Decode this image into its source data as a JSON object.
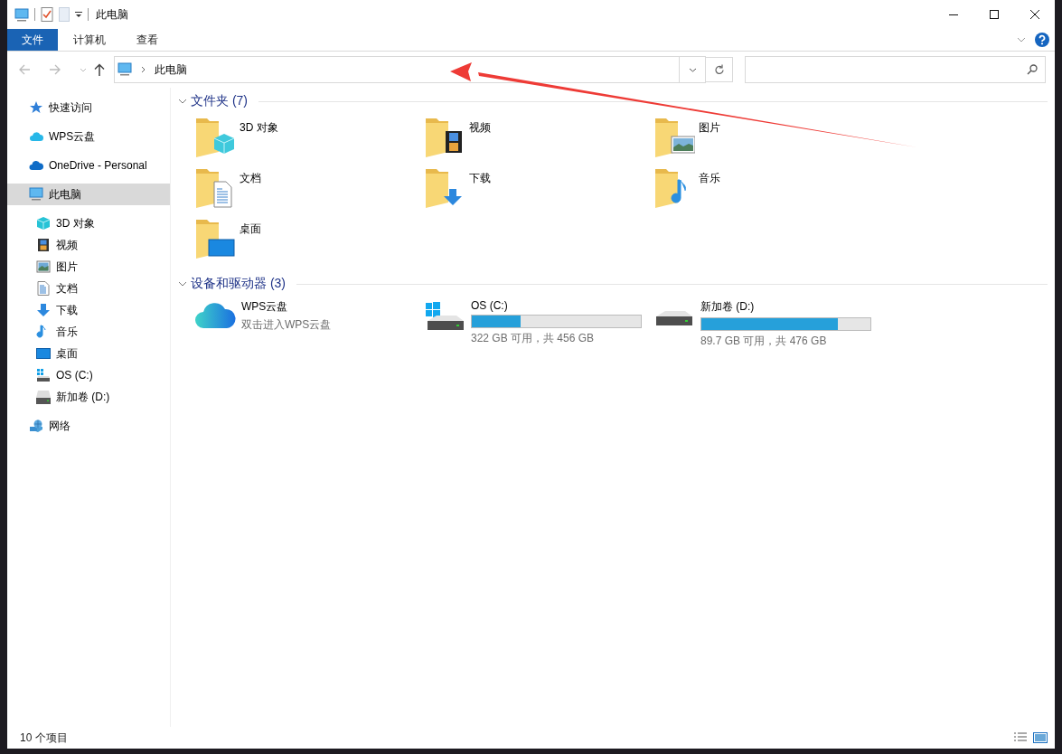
{
  "window": {
    "title": "此电脑"
  },
  "ribbon_tabs": [
    {
      "label": "文件",
      "selected": true
    },
    {
      "label": "计算机",
      "selected": false
    },
    {
      "label": "查看",
      "selected": false
    }
  ],
  "address_bar": {
    "path": "此电脑"
  },
  "sidebar": {
    "items": [
      {
        "label": "快速访问",
        "selected": false
      },
      {
        "label": "WPS云盘",
        "selected": false
      },
      {
        "label": "OneDrive - Personal",
        "selected": false
      },
      {
        "label": "此电脑",
        "selected": true,
        "children": [
          {
            "label": "3D 对象",
            "selected": false
          },
          {
            "label": "视频",
            "selected": false
          },
          {
            "label": "图片",
            "selected": false
          },
          {
            "label": "文档",
            "selected": false
          },
          {
            "label": "下载",
            "selected": false
          },
          {
            "label": "音乐",
            "selected": false
          },
          {
            "label": "桌面",
            "selected": false
          },
          {
            "label": "OS (C:)",
            "selected": false
          },
          {
            "label": "新加卷 (D:)",
            "selected": false
          }
        ]
      },
      {
        "label": "网络",
        "selected": false
      }
    ]
  },
  "sections": [
    {
      "title": "文件夹 (7)",
      "expanded": true,
      "items": [
        {
          "kind": "folder",
          "name": "3D 对象"
        },
        {
          "kind": "folder",
          "name": "视频"
        },
        {
          "kind": "folder",
          "name": "图片"
        },
        {
          "kind": "folder",
          "name": "文档"
        },
        {
          "kind": "folder",
          "name": "下载"
        },
        {
          "kind": "folder",
          "name": "音乐"
        },
        {
          "kind": "folder",
          "name": "桌面"
        }
      ]
    },
    {
      "title": "设备和驱动器 (3)",
      "expanded": true,
      "items": [
        {
          "kind": "cloud",
          "name": "WPS云盘",
          "subtitle": "双击进入WPS云盘"
        },
        {
          "kind": "drive",
          "name": "OS (C:)",
          "level": 0.29,
          "reading": "322 GB 可用，共 456 GB"
        },
        {
          "kind": "drive",
          "name": "新加卷 (D:)",
          "level": 0.81,
          "reading": "89.7 GB 可用，共 476 GB"
        }
      ]
    }
  ],
  "status_bar": {
    "count": "10 个项目"
  }
}
